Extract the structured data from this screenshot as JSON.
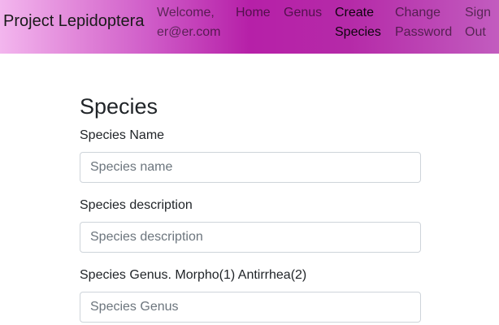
{
  "nav": {
    "brand": "Project Lepidoptera",
    "welcome_line1": "Welcome,",
    "welcome_line2": "er@er.com",
    "home": "Home",
    "genus": "Genus",
    "create_line1": "Create",
    "create_line2": "Species",
    "change_line1": "Change",
    "change_line2": "Password",
    "signout_line1": "Sign",
    "signout_line2": "Out"
  },
  "form": {
    "title": "Species",
    "name_label": "Species Name",
    "name_placeholder": "Species name",
    "description_label": "Species description",
    "description_placeholder": "Species description",
    "genus_label": "Species Genus. Morpho(1) Antirrhea(2)",
    "genus_placeholder": "Species Genus"
  }
}
